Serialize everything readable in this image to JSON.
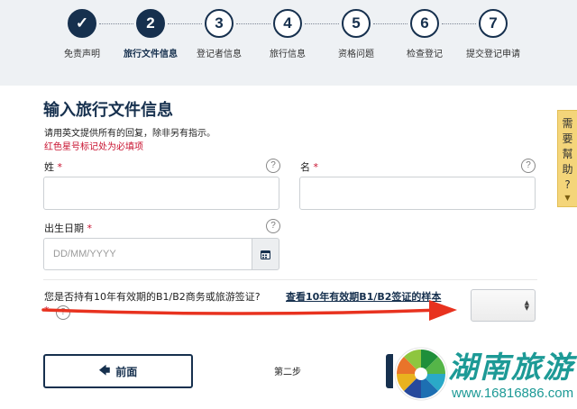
{
  "steps": [
    {
      "number": "✓",
      "label": "免责声明",
      "state": "done"
    },
    {
      "number": "2",
      "label": "旅行文件信息",
      "state": "active"
    },
    {
      "number": "3",
      "label": "登记者信息",
      "state": "todo"
    },
    {
      "number": "4",
      "label": "旅行信息",
      "state": "todo"
    },
    {
      "number": "5",
      "label": "资格问题",
      "state": "todo"
    },
    {
      "number": "6",
      "label": "检查登记",
      "state": "todo"
    },
    {
      "number": "7",
      "label": "提交登记申请",
      "state": "todo"
    }
  ],
  "help_tab": {
    "chars": [
      "需",
      "要",
      "幫",
      "助",
      "?"
    ],
    "icon": "caret-down-icon"
  },
  "form": {
    "title": "输入旅行文件信息",
    "instructions": "请用英文提供所有的回复，除非另有指示。",
    "required_note": "红色星号标记处为必填项",
    "surname_label": "姓",
    "given_name_label": "名",
    "dob_label": "出生日期",
    "dob_placeholder": "DD/MM/YYYY",
    "required_mark": "*",
    "help_mark": "?",
    "visa_question": "您是否持有10年有效期的B1/B2商务或旅游签证?",
    "visa_sample_link": "查看10年有效期B1/B2签证的样本",
    "visa_select_value": ""
  },
  "footer": {
    "back_label": "前面",
    "step_text": "第二步"
  },
  "watermark": {
    "text": "湖南旅游",
    "url": "www.16816886.com"
  },
  "colors": {
    "navy": "#16304e",
    "required_red": "#c8102e",
    "help_yellow": "#f4d57a",
    "annotation_red": "#e8321f",
    "watermark_teal": "#1d9a96"
  }
}
